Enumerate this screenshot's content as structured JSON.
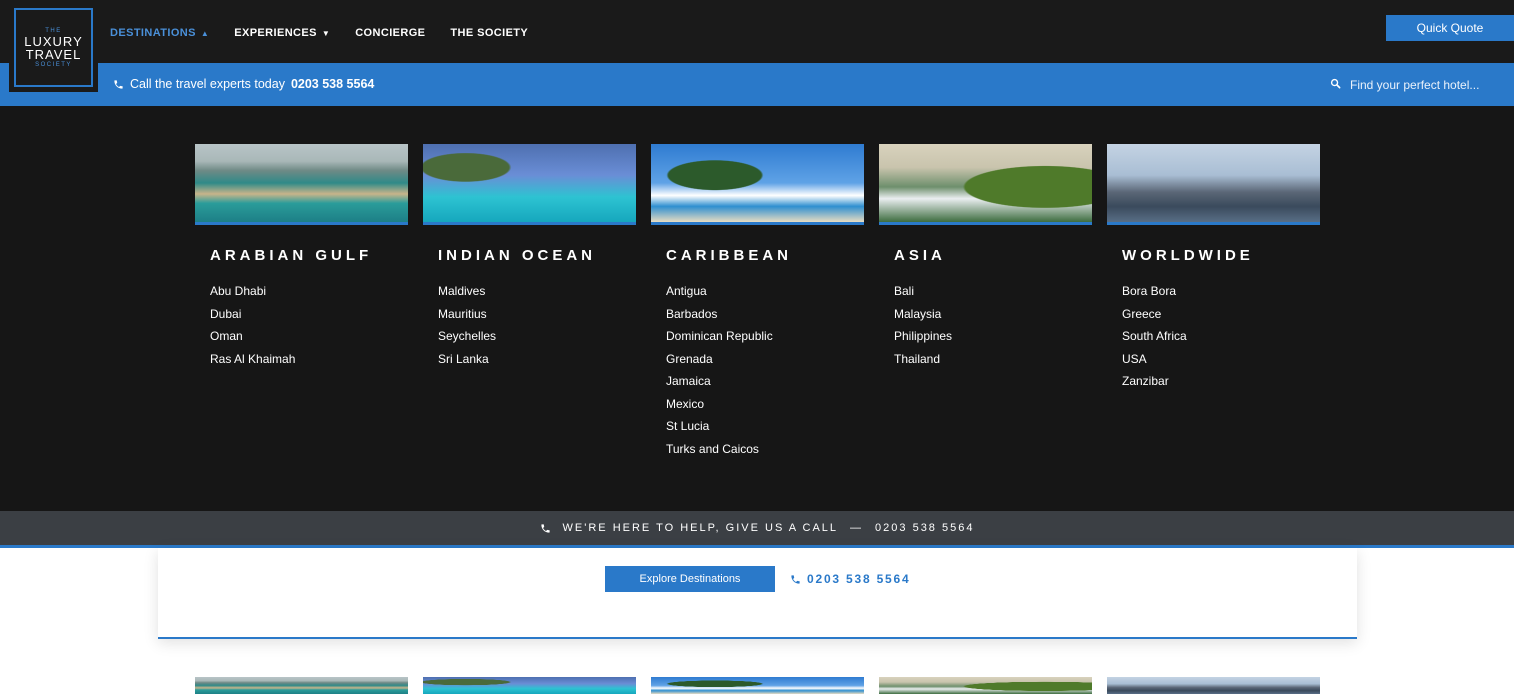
{
  "logo": {
    "line_top": "THE",
    "line1": "LUXURY",
    "line2": "TRAVEL",
    "line_bottom": "SOCIETY"
  },
  "nav": {
    "items": [
      {
        "label": "DESTINATIONS",
        "caret": "▲"
      },
      {
        "label": "EXPERIENCES",
        "caret": "▼"
      },
      {
        "label": "CONCIERGE"
      },
      {
        "label": "THE SOCIETY"
      }
    ],
    "quote_label": "Quick Quote"
  },
  "callbar": {
    "text": "Call the travel experts today",
    "phone": "0203 538 5564",
    "search_placeholder": "Find your perfect hotel..."
  },
  "menu": {
    "columns": [
      {
        "title": "ARABIAN GULF",
        "image": "palm-island-photo",
        "items": [
          "Abu Dhabi",
          "Dubai",
          "Oman",
          "Ras Al Khaimah"
        ]
      },
      {
        "title": "INDIAN OCEAN",
        "image": "overwater-villa-photo",
        "items": [
          "Maldives",
          "Mauritius",
          "Seychelles",
          "Sri Lanka"
        ]
      },
      {
        "title": "CARIBBEAN",
        "image": "palm-beach-photo",
        "items": [
          "Antigua",
          "Barbados",
          "Dominican Republic",
          "Grenada",
          "Jamaica",
          "Mexico",
          "St Lucia",
          "Turks and Caicos"
        ]
      },
      {
        "title": "ASIA",
        "image": "cliff-coast-photo",
        "items": [
          "Bali",
          "Malaysia",
          "Philippines",
          "Thailand"
        ]
      },
      {
        "title": "WORLDWIDE",
        "image": "city-skyline-photo",
        "items": [
          "Bora Bora",
          "Greece",
          "South Africa",
          "USA",
          "Zanzibar"
        ]
      }
    ]
  },
  "helpbar": {
    "text": "WE'RE HERE TO HELP, GIVE US A CALL",
    "dash": "—",
    "phone": "0203 538 5564"
  },
  "card": {
    "explore_label": "Explore Destinations",
    "phone": "0203 538 5564"
  },
  "icons": {
    "phone": "phone-icon",
    "search": "search-icon",
    "caret": "caret-icon"
  },
  "colors": {
    "accent": "#2a79c9",
    "nav_bg": "#1a1a1a",
    "menu_bg": "#161616",
    "help_bg": "#3b3f44"
  }
}
